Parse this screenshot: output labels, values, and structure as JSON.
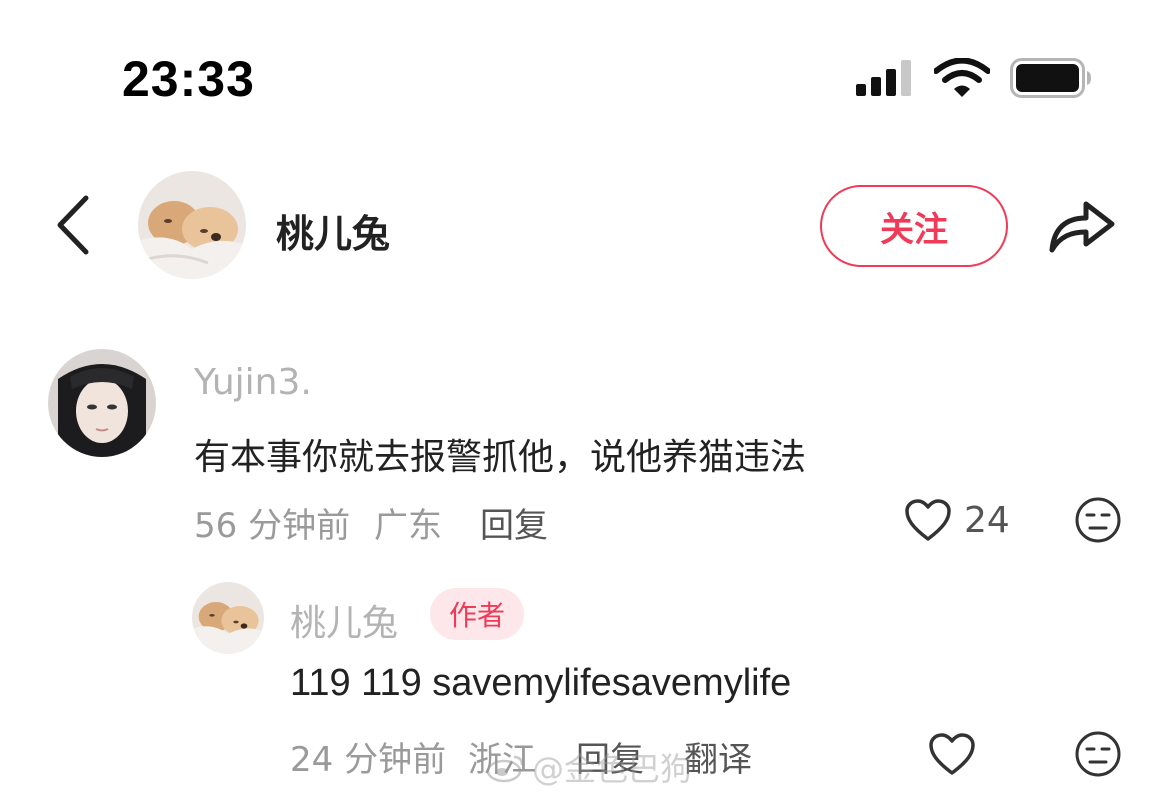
{
  "status_bar": {
    "time": "23:33"
  },
  "header": {
    "name": "桃儿兔",
    "follow_label": "关注"
  },
  "comments": [
    {
      "username": "Yujin3.",
      "text": "有本事你就去报警抓他，说他养猫违法",
      "time": "56 分钟前",
      "location": "广东",
      "reply_label": "回复",
      "likes": "24"
    }
  ],
  "replies": [
    {
      "username": "桃儿兔",
      "badge": "作者",
      "text": "119 119 savemylifesavemylife",
      "time": "24 分钟前",
      "location": "浙江",
      "reply_label": "回复",
      "translate_label": "翻译"
    }
  ],
  "watermark": "@金色巴狗",
  "colors": {
    "accent": "#ef3a58",
    "badge_bg": "#fde7ea"
  },
  "icons": [
    "signal-icon",
    "wifi-icon",
    "battery-icon",
    "back-icon",
    "share-icon",
    "heart-icon",
    "emoji-icon"
  ]
}
